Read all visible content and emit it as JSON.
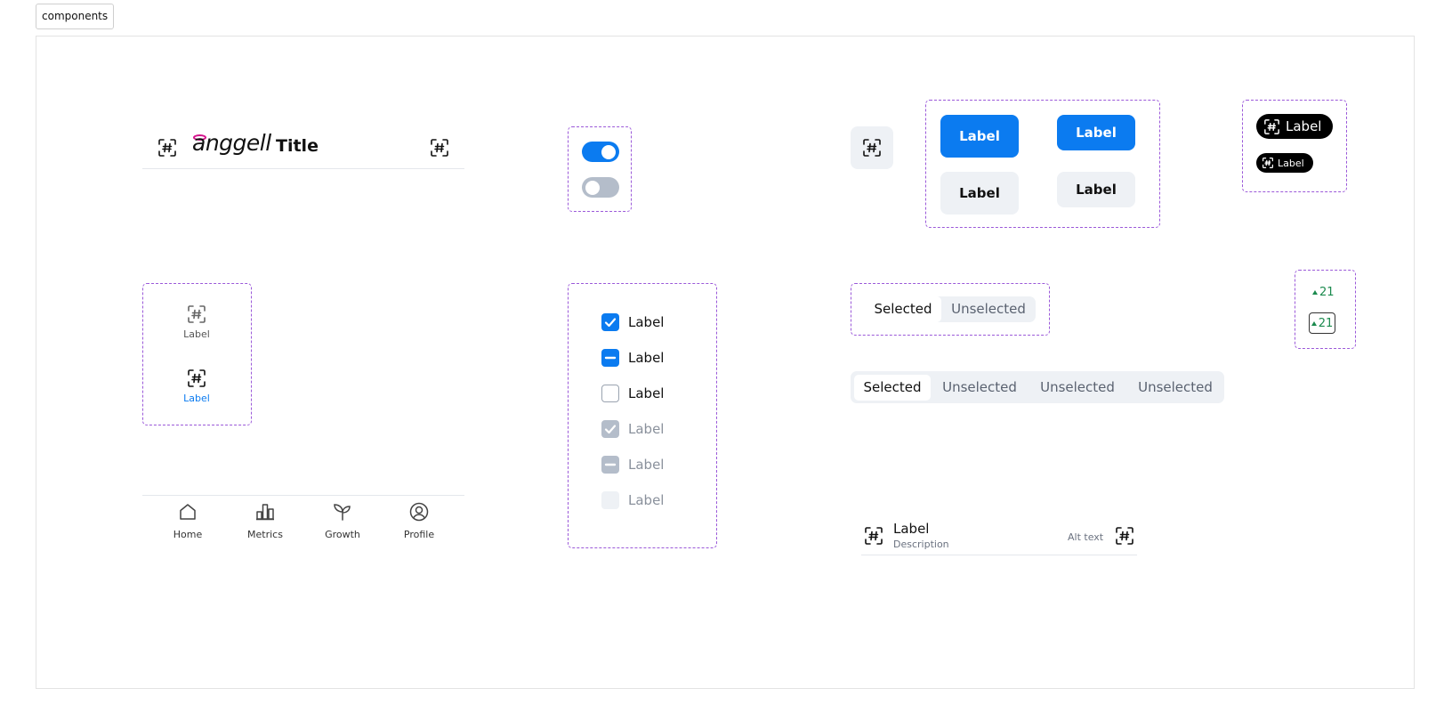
{
  "frame": {
    "label": "components"
  },
  "header": {
    "logo": "anggell",
    "title": "Title",
    "left_icon": "hash-frame-icon",
    "right_icon": "hash-frame-icon"
  },
  "toggles": [
    {
      "state": "on"
    },
    {
      "state": "off"
    }
  ],
  "icon_tile": {
    "icon": "hash-frame-icon"
  },
  "buttons": {
    "primary_large": "Label",
    "primary_small": "Label",
    "secondary_large": "Label",
    "secondary_small": "Label"
  },
  "chips": {
    "large": "Label",
    "small": "Label",
    "icon": "hash-frame-icon"
  },
  "nav_tiles": [
    {
      "label": "Label",
      "state": "default"
    },
    {
      "label": "Label",
      "state": "active"
    }
  ],
  "checkboxes": [
    {
      "label": "Label",
      "state": "checked"
    },
    {
      "label": "Label",
      "state": "indeterminate"
    },
    {
      "label": "Label",
      "state": "unchecked"
    },
    {
      "label": "Label",
      "state": "checked-disabled"
    },
    {
      "label": "Label",
      "state": "indeterminate-disabled"
    },
    {
      "label": "Label",
      "state": "unchecked-disabled"
    }
  ],
  "segmented_small": [
    "Selected",
    "Unselected"
  ],
  "segmented_large": [
    "Selected",
    "Unselected",
    "Unselected",
    "Unselected"
  ],
  "trend_badges": {
    "plain": "21",
    "boxed": "21"
  },
  "tabbar": [
    {
      "label": "Home",
      "icon": "home-icon"
    },
    {
      "label": "Metrics",
      "icon": "bar-chart-icon"
    },
    {
      "label": "Growth",
      "icon": "sprout-icon"
    },
    {
      "label": "Profile",
      "icon": "user-circle-icon"
    }
  ],
  "list_item": {
    "label": "Label",
    "description": "Description",
    "alt_text": "Alt text"
  },
  "colors": {
    "primary": "#0b7bf0",
    "dashed_border": "#9b59d9",
    "success": "#1b8a4e",
    "logo_halo": "#d4148c",
    "surface": "#eef1f5"
  }
}
